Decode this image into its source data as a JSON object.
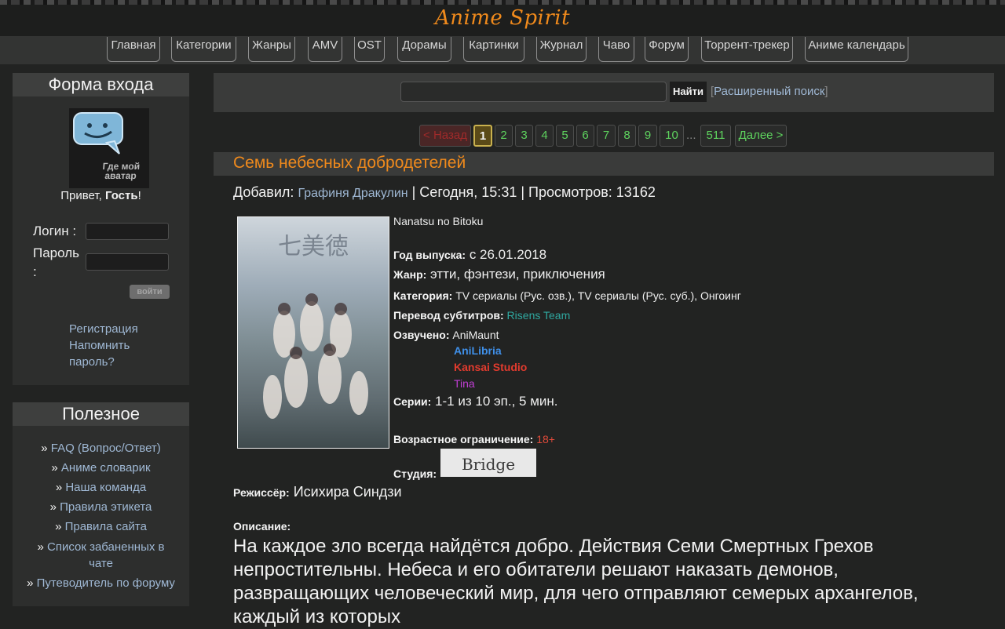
{
  "site": {
    "title": "Anime Spirit"
  },
  "nav": [
    "Главная",
    "Категории",
    "Жанры",
    "AMV",
    "OST",
    "Дорамы",
    "Картинки",
    "Журнал",
    "Чаво",
    "Форум",
    "Торрент-трекер",
    "Аниме календарь"
  ],
  "login": {
    "title": "Форма входа",
    "avatar_text": "Где мой аватар",
    "greeting_prefix": "Привет, ",
    "guest": "Гость",
    "greeting_suffix": "!",
    "login_label": "Логин :",
    "password_label_1": "Пароль",
    "password_label_2": ":",
    "submit": "войти",
    "register": "Регистрация",
    "remind_1": "Напомнить",
    "remind_2": "пароль?"
  },
  "useful": {
    "title": "Полезное",
    "bullet": "»",
    "items": [
      "FAQ (Вопрос/Ответ)",
      "Аниме словарик",
      "Наша команда",
      "Правила этикета",
      "Правила сайта",
      "Список забаненных в",
      "чате",
      "Путеводитель по форуму"
    ]
  },
  "search": {
    "value": "",
    "button": "Найти",
    "advanced": "Расширенный поиск",
    "bracket_open": "[",
    "bracket_close": "]"
  },
  "pagination": {
    "prev": "< Назад",
    "pages": [
      "1",
      "2",
      "3",
      "4",
      "5",
      "6",
      "7",
      "8",
      "9",
      "10"
    ],
    "dots": "...",
    "last": "511",
    "next": "Далее >"
  },
  "post": {
    "title": "Семь небесных добродетелей",
    "added_label": "Добавил: ",
    "author": "Графиня Дракулин",
    "date_views": " | Сегодня, 15:31 | Просмотров: 13162",
    "original_title": "Nanatsu no Bitoku",
    "year_label": "Год выпуска:",
    "year_value": " с 26.01.2018",
    "genre_label": "Жанр:",
    "genre_value": " этти, фэнтези, приключения",
    "category_label": "Категория:",
    "category_value": " TV сериалы (Рус. озв.), TV сериалы (Рус. суб.), Онгоинг",
    "subs_label": "Перевод субтитров:",
    "subs_value": " Risens Team",
    "dub_label": "Озвучено:",
    "dub_first": " AniMaunt",
    "dubs": [
      {
        "name": "AniLibria",
        "color": "#3f8fe8"
      },
      {
        "name": "Kansai Studio",
        "color": "#e23b2e"
      },
      {
        "name": "Tina",
        "color": "#c03fd4"
      }
    ],
    "episodes_label": "Серии:",
    "episodes_value": " 1-1 из 10 эп., 5 мин.",
    "age_label": "Возрастное ограничение:",
    "age_value": " 18+",
    "studio_label": "Студия:",
    "studio_logo": "Bridge",
    "director_label": "Режиссёр:",
    "director_value": " Исихира Синдзи",
    "desc_label": "Описание:",
    "desc": "На каждое зло всегда найдётся добро. Действия Семи Смертных Грехов непростительны. Небеса и его обитатели решают наказать демонов, развращающих человеческий мир, для чего отправляют семерых архангелов, каждый из которых"
  },
  "colors": {
    "accent": "#f08a1c",
    "link": "#9fb8d4",
    "page_link": "#5ed35e",
    "subs_link": "#2fa8a0",
    "age": "#e04a3a"
  }
}
